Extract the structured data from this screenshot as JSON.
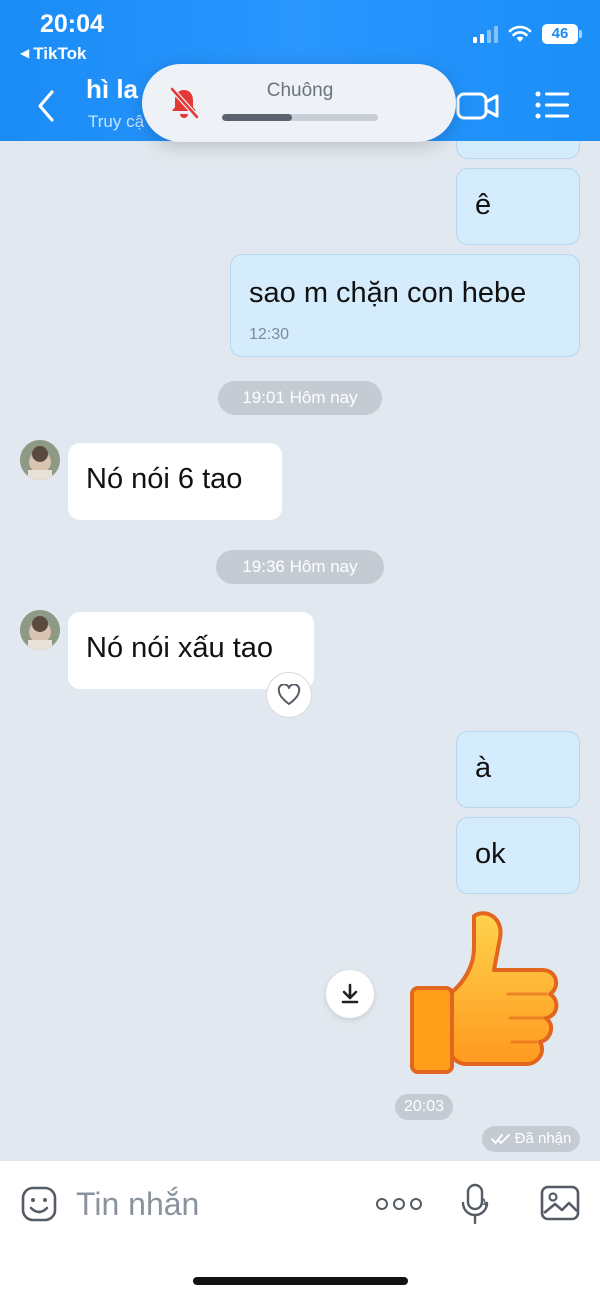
{
  "status_bar": {
    "time": "20:04",
    "back_app": "TikTok",
    "battery": "46"
  },
  "header": {
    "contact_name": "hì la",
    "contact_status": "Truy cậ"
  },
  "ringer": {
    "label": "Chuông",
    "level": 0.45
  },
  "messages": {
    "out_1": "ê",
    "out_2": "sao m chặn con hebe",
    "out_2_time": "12:30",
    "sep_1": "19:01 Hôm nay",
    "in_1": "Nó nói 6 tao",
    "sep_2": "19:36 Hôm nay",
    "in_2": "Nó nói xấu tao",
    "out_3": "à",
    "out_4": "ok",
    "sticker_time": "20:03",
    "delivered": "Đã nhận"
  },
  "input": {
    "placeholder": "Tin nhắn"
  },
  "colors": {
    "header": "#1a8cf5",
    "chat_bg": "#e2e8ef",
    "out_bubble": "#d4ecfc",
    "in_bubble": "#ffffff"
  }
}
